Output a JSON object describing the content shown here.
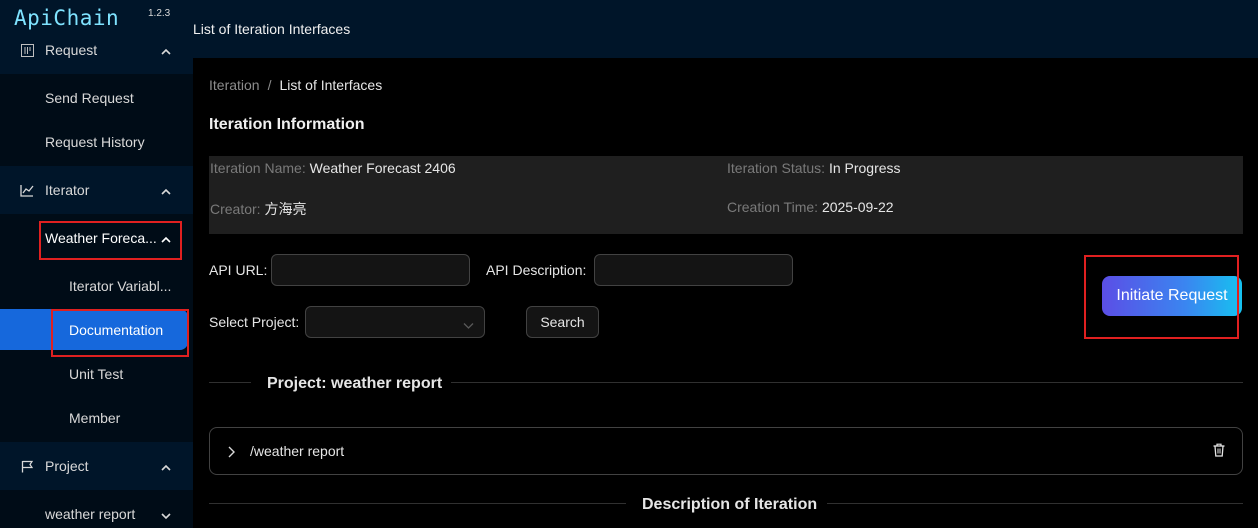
{
  "app": {
    "logo": "ApiChain",
    "version": "1.2.3"
  },
  "sidebar": {
    "groups": [
      {
        "label": "Request",
        "icon": "request-icon"
      },
      {
        "label": "Iterator",
        "icon": "chart-line-icon"
      },
      {
        "label": "Project",
        "icon": "flag-icon"
      }
    ],
    "request_items": [
      "Send Request",
      "Request History"
    ],
    "iterator_sub": "Weather Foreca...",
    "iterator_items": [
      "Iterator Variabl...",
      "Documentation",
      "Unit Test",
      "Member"
    ],
    "project_items": [
      "weather report"
    ]
  },
  "header": {
    "title": "List of Iteration Interfaces"
  },
  "breadcrumb": {
    "root": "Iteration",
    "sep": "/",
    "current": "List of Interfaces"
  },
  "info": {
    "title": "Iteration Information",
    "name_label": "Iteration Name:",
    "name_value": "Weather Forecast 2406",
    "status_label": "Iteration Status:",
    "status_value": "In Progress",
    "creator_label": "Creator:",
    "creator_value": "方海亮",
    "time_label": "Creation Time:",
    "time_value": "2025-09-22"
  },
  "form": {
    "api_url_label": "API URL:",
    "api_url_value": "",
    "api_desc_label": "API Description:",
    "api_desc_value": "",
    "project_label": "Select Project:",
    "project_value": "",
    "search_label": "Search",
    "initiate_label": "Initiate Request"
  },
  "project_section": {
    "title": "Project: weather report",
    "item": "/weather report"
  },
  "description_section": {
    "title": "Description of Iteration"
  }
}
